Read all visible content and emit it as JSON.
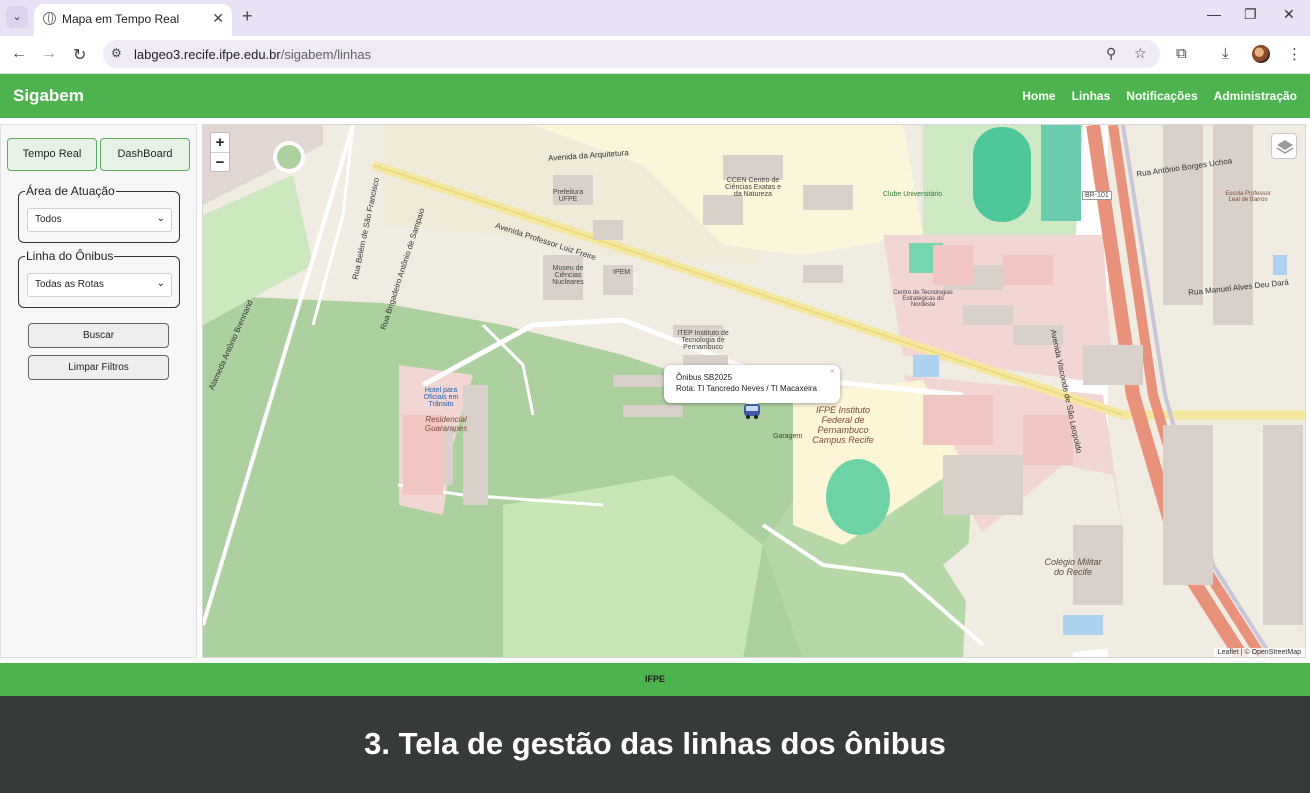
{
  "browser": {
    "tab_title": "Mapa em Tempo Real",
    "url_host": "labgeo3.recife.ifpe.edu.br",
    "url_path": "/sigabem/linhas"
  },
  "header": {
    "brand": "Sigabem",
    "nav": [
      "Home",
      "Linhas",
      "Notificações",
      "Administração"
    ]
  },
  "sidebar": {
    "tabs": [
      "Tempo Real",
      "DashBoard"
    ],
    "area_label": "Área de Atuação",
    "area_value": "Todos",
    "line_label": "Linha do Ônibus",
    "line_value": "Todas as Rotas",
    "search_button": "Buscar",
    "clear_button": "Limpar Filtros"
  },
  "map": {
    "zoom_in": "+",
    "zoom_out": "−",
    "popup": {
      "line1": "Ônibus SB2025",
      "line2": "Rota: TI Tancredo Neves / TI Macaxeira",
      "close": "×"
    },
    "attribution": "Leaflet | © OpenStreetMap",
    "labels": [
      "Avenida Professor Luiz Freire",
      "Avenida da Arquitetura",
      "CCEN Centro de Ciências Exatas e da Natureza",
      "Prefeitura UFPE",
      "Museu de Ciências Nucleares",
      "IPEM",
      "ITEP Instituto de Tecnologia de Pernambuco",
      "IFPE Instituto Federal de Pernambuco Campus Recife",
      "Hotel para Oficiais em Trânsito",
      "Residencial Guararapes",
      "Colégio Militar do Recife",
      "Avenida Visconde de São Leopoldo",
      "Rua Manuel Alves Deu Dará",
      "Clube Universitário",
      "Centro de Tecnologias Estratégicas do Nordeste",
      "BR-101",
      "Rua Brigadeiro Antônio de Sampaio",
      "Rua Belém de São Francisco",
      "Alameda Antônio Brennand",
      "Rua Antônio Borges Uchoa",
      "Escola Professor Leal de Barros",
      "Garagem"
    ]
  },
  "footer": {
    "text": "IFPE"
  },
  "caption": "3. Tela de gestão das linhas dos ônibus"
}
